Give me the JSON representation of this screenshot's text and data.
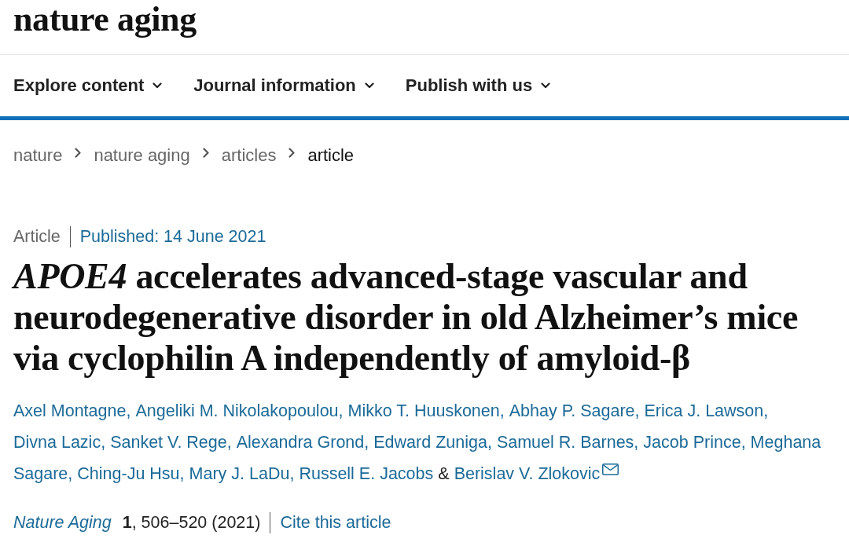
{
  "header": {
    "logo": "nature aging"
  },
  "nav": {
    "items": [
      {
        "label": "Explore content"
      },
      {
        "label": "Journal information"
      },
      {
        "label": "Publish with us"
      }
    ]
  },
  "breadcrumb": [
    {
      "label": "nature",
      "current": false
    },
    {
      "label": "nature aging",
      "current": false
    },
    {
      "label": "articles",
      "current": false
    },
    {
      "label": "article",
      "current": true
    }
  ],
  "article": {
    "type": "Article",
    "published": "Published: 14 June 2021",
    "title": "*APOE4* accelerates advanced-stage vascular and neurodegenerative disorder in old Alzheimer’s mice via cyclophilin A independently of amyloid-β",
    "authors": {
      "lines": [
        [
          {
            "kind": "author",
            "name": "Axel Montagne",
            "suffix": ",",
            "corresponding": false
          },
          {
            "kind": "author",
            "name": "Angeliki M. Nikolakopoulou",
            "suffix": ",",
            "corresponding": false
          },
          {
            "kind": "author",
            "name": "Mikko T. Huuskonen",
            "suffix": ",",
            "corresponding": false
          },
          {
            "kind": "author",
            "name": "Abhay P. Sagare",
            "suffix": ",",
            "corresponding": false
          },
          {
            "kind": "author",
            "name": "Erica J. Lawson",
            "suffix": ",",
            "corresponding": false
          }
        ],
        [
          {
            "kind": "author",
            "name": "Divna Lazic",
            "suffix": ",",
            "corresponding": false
          },
          {
            "kind": "author",
            "name": "Sanket V. Rege",
            "suffix": ",",
            "corresponding": false
          },
          {
            "kind": "author",
            "name": "Alexandra Grond",
            "suffix": ",",
            "corresponding": false
          },
          {
            "kind": "author",
            "name": "Edward Zuniga",
            "suffix": ",",
            "corresponding": false
          },
          {
            "kind": "author",
            "name": "Samuel R. Barnes",
            "suffix": ",",
            "corresponding": false
          },
          {
            "kind": "author",
            "name": "Jacob Prince",
            "suffix": ",",
            "corresponding": false
          },
          {
            "kind": "author",
            "name": "Meghana",
            "corresponding": false
          }
        ],
        [
          {
            "kind": "author",
            "name": "Sagare",
            "suffix": ",",
            "corresponding": false
          },
          {
            "kind": "author",
            "name": "Ching-Ju Hsu",
            "suffix": ",",
            "corresponding": false
          },
          {
            "kind": "author",
            "name": "Mary J. LaDu",
            "suffix": ",",
            "corresponding": false
          },
          {
            "kind": "author",
            "name": "Russell E. Jacobs",
            "corresponding": false
          },
          {
            "kind": "conjunction",
            "text": "&"
          },
          {
            "kind": "author",
            "name": "Berislav V. Zlokovic",
            "corresponding": true
          }
        ]
      ]
    },
    "citation": {
      "journal": "Nature Aging",
      "details": "**1**, 506–520 (2021)",
      "cite_label": "Cite this article"
    }
  }
}
